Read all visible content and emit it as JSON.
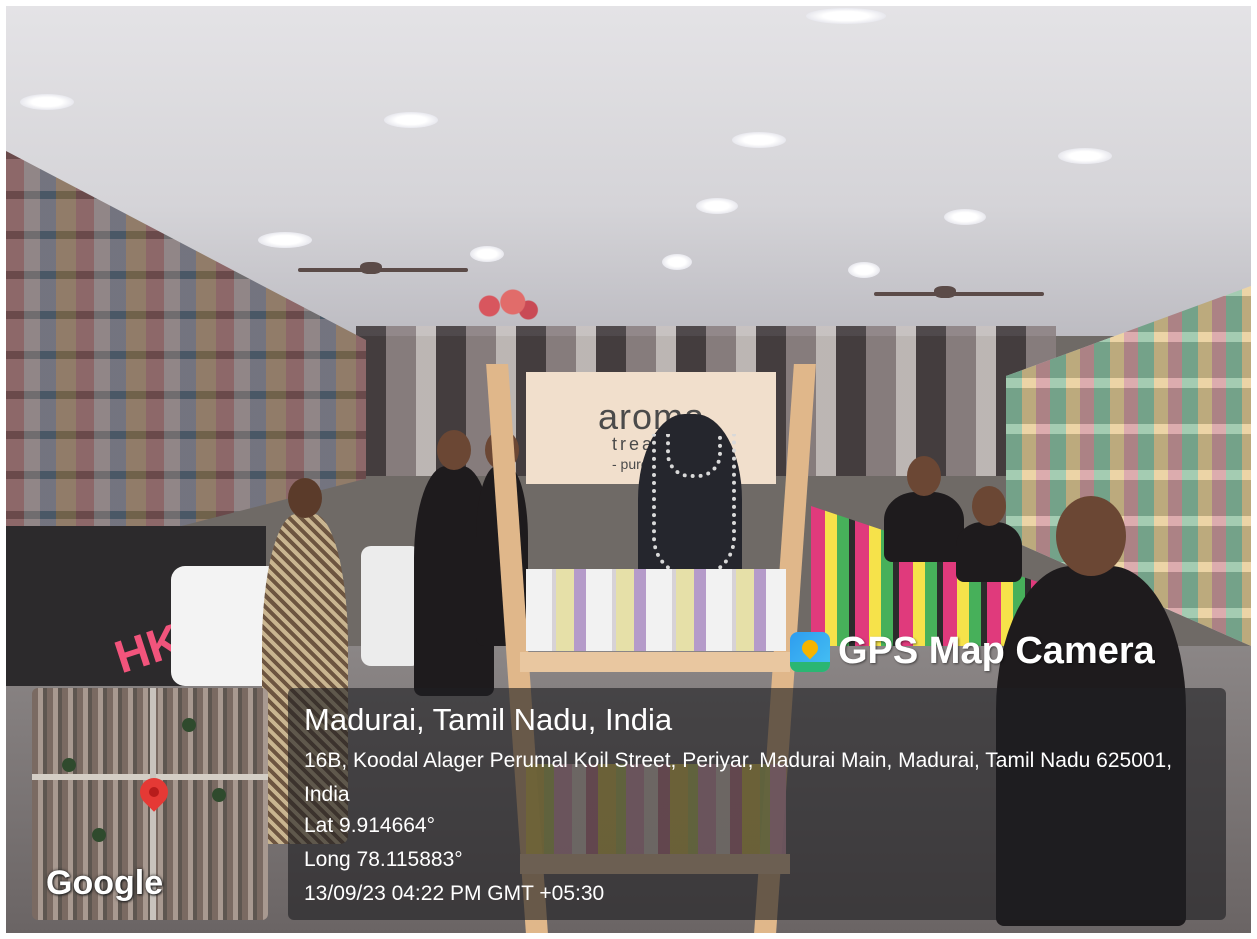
{
  "overlay": {
    "brand_title": "GPS Map Camera",
    "brand_icon": "gps-map-camera-icon",
    "location_title": "Madurai, Tamil Nadu, India",
    "address": "16B, Koodal Alager Perumal Koil Street, Periyar, Madurai Main, Madurai, Tamil Nadu 625001, India",
    "latitude": "Lat 9.914664°",
    "longitude": "Long 78.115883°",
    "datetime": "13/09/23 04:22 PM GMT +05:30",
    "map_provider": "Google",
    "map_pin_icon": "map-pin-icon"
  },
  "scene": {
    "store_sign": "HKA",
    "display_brand": "aroma",
    "display_sub": "trea",
    "display_tag": "- pure"
  },
  "colors": {
    "panel_background": "rgba(30,30,34,0.62)",
    "pin": "#e53935",
    "text": "#ffffff"
  }
}
